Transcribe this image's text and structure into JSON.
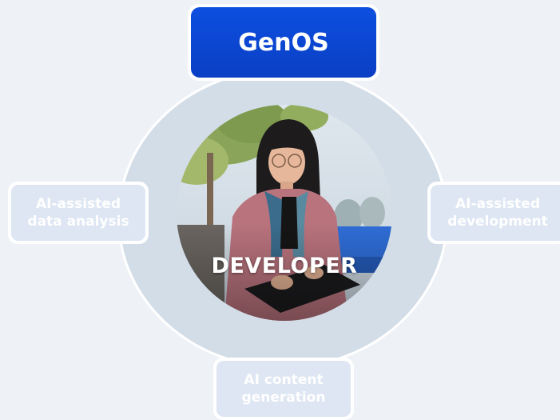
{
  "diagram": {
    "top_node": {
      "label": "GenOS"
    },
    "center": {
      "label": "DEVELOPER",
      "image": "woman-with-laptop-photo"
    },
    "left_node": {
      "line1": "AI-assisted",
      "line2": "data analysis"
    },
    "right_node": {
      "line1": "AI-assisted",
      "line2": "development"
    },
    "bottom_node": {
      "line1": "AI content",
      "line2": "generation"
    }
  },
  "colors": {
    "background": "#eef2f7",
    "ring": "#d3dde8",
    "accent": "#0d4fe0",
    "faded_node": "#dde6f2",
    "text_light": "#ffffff"
  }
}
